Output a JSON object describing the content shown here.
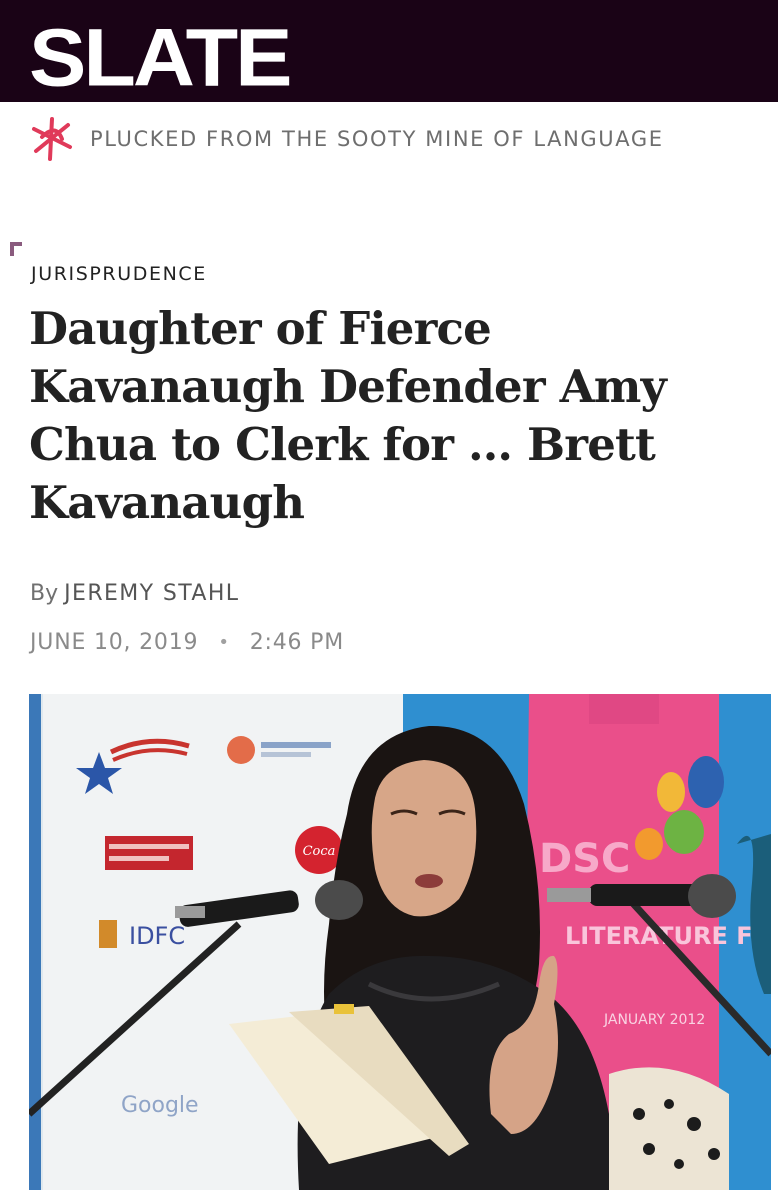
{
  "header": {
    "logo_text": "SLATE",
    "tagline": "PLUCKED FROM THE SOOTY MINE OF LANGUAGE",
    "tagline_icon": "asterisk-star-icon",
    "background_color": "#1a0316",
    "icon_color": "#e03a5a"
  },
  "article": {
    "category": "JURISPRUDENCE",
    "headline": "Daughter of Fierce Kavanaugh Defender Amy Chua to Clerk for … Brett Kavanaugh",
    "byline_prefix": "By",
    "author": "JEREMY STAHL",
    "date": "JUNE 10, 2019",
    "separator": "•",
    "time": "2:46 PM"
  },
  "photo": {
    "banner_text": "LITERATURE FESTIVAL",
    "banner_date": "JANUARY 2012",
    "sponsor_google": "Google",
    "sponsor_idfc": "IDFC",
    "sponsor_dsc": "DSC"
  }
}
